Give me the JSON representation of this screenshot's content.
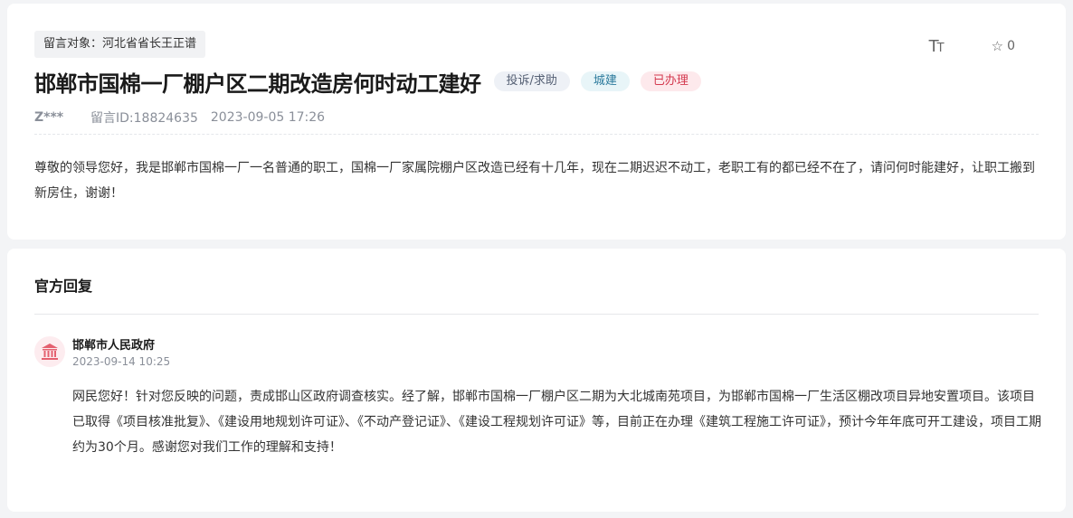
{
  "message": {
    "target": "留言对象：河北省省长王正谱",
    "toolbar": {
      "font_size_icon": "text-size-icon",
      "favorite_icon": "star-icon",
      "favorite_count": "0"
    },
    "title": "邯郸市国棉一厂棚户区二期改造房何时动工建好",
    "badges": {
      "type": "投诉/求助",
      "category": "城建",
      "status": "已办理"
    },
    "author": "Z***",
    "message_id": "留言ID:18824635",
    "datetime": "2023-09-05 17:26",
    "content": "尊敬的领导您好，我是邯郸市国棉一厂一名普通的职工，国棉一厂家属院棚户区改造已经有十几年，现在二期迟迟不动工，老职工有的都已经不在了，请问何时能建好，让职工搬到新房住，谢谢！"
  },
  "reply": {
    "section_title": "官方回复",
    "org_icon": "government-building-icon",
    "org_name": "邯郸市人民政府",
    "datetime": "2023-09-14 10:25",
    "content": "网民您好！针对您反映的问题，责成邯山区政府调查核实。经了解，邯郸市国棉一厂棚户区二期为大北城南苑项目，为邯郸市国棉一厂生活区棚改项目异地安置项目。该项目已取得《项目核准批复》、《建设用地规划许可证》、《不动产登记证》、《建设工程规划许可证》等，目前正在办理《建筑工程施工许可证》，预计今年年底可开工建设，项目工期约为30个月。感谢您对我们工作的理解和支持！"
  },
  "colors": {
    "status_badge": "#d43a50",
    "category_badge": "#2b7a9c",
    "page_background": "#f3f4f6"
  }
}
